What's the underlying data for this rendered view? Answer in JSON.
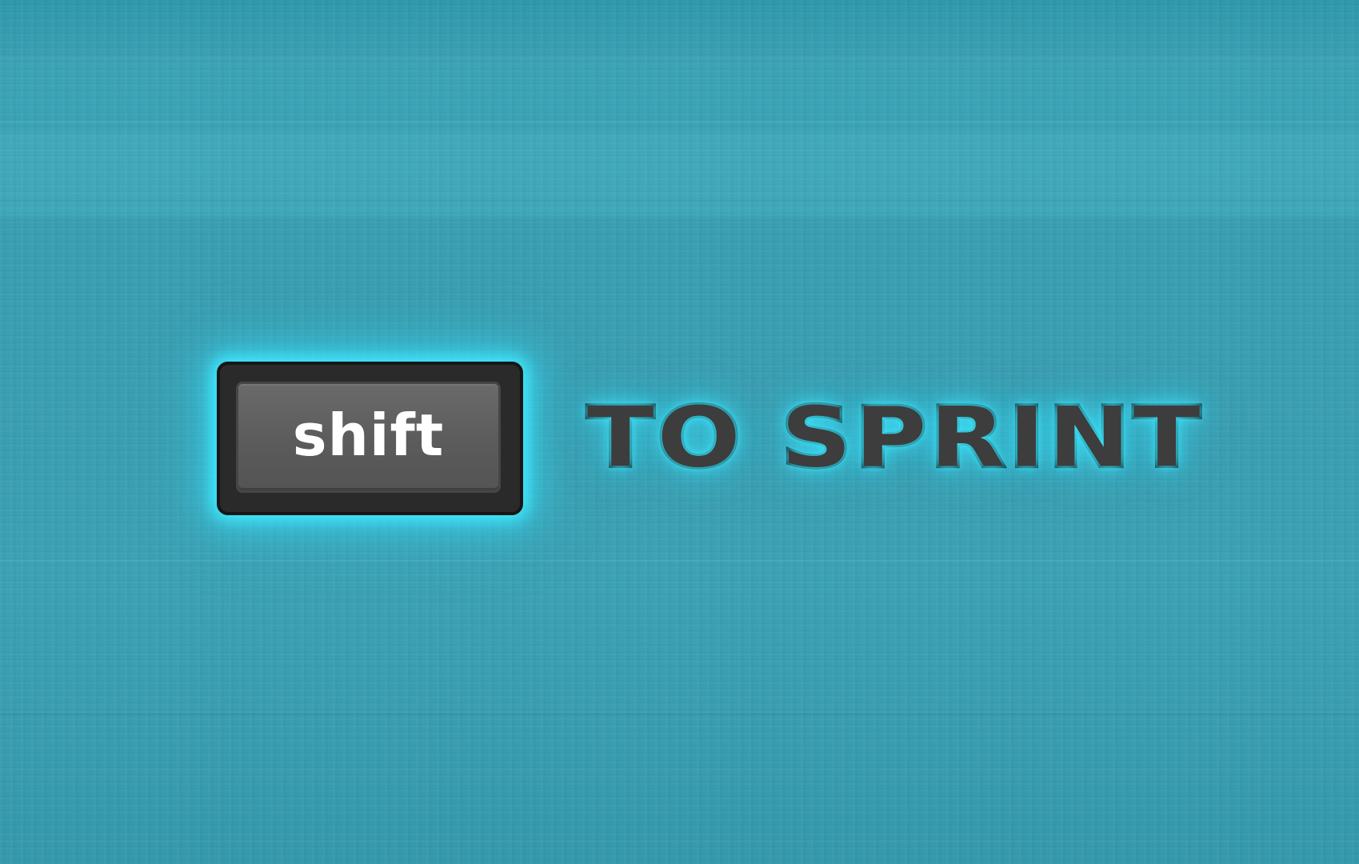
{
  "prompt": {
    "key_label": "shift",
    "action_text": "TO SPRINT"
  },
  "colors": {
    "background": "#3a9fb2",
    "glow": "#40ebff",
    "key_body": "#2a2a2a",
    "key_face": "#5f5f5f",
    "key_text": "#ffffff",
    "action_text_fill": "#3d3d3d",
    "action_text_outline": "#111111"
  }
}
